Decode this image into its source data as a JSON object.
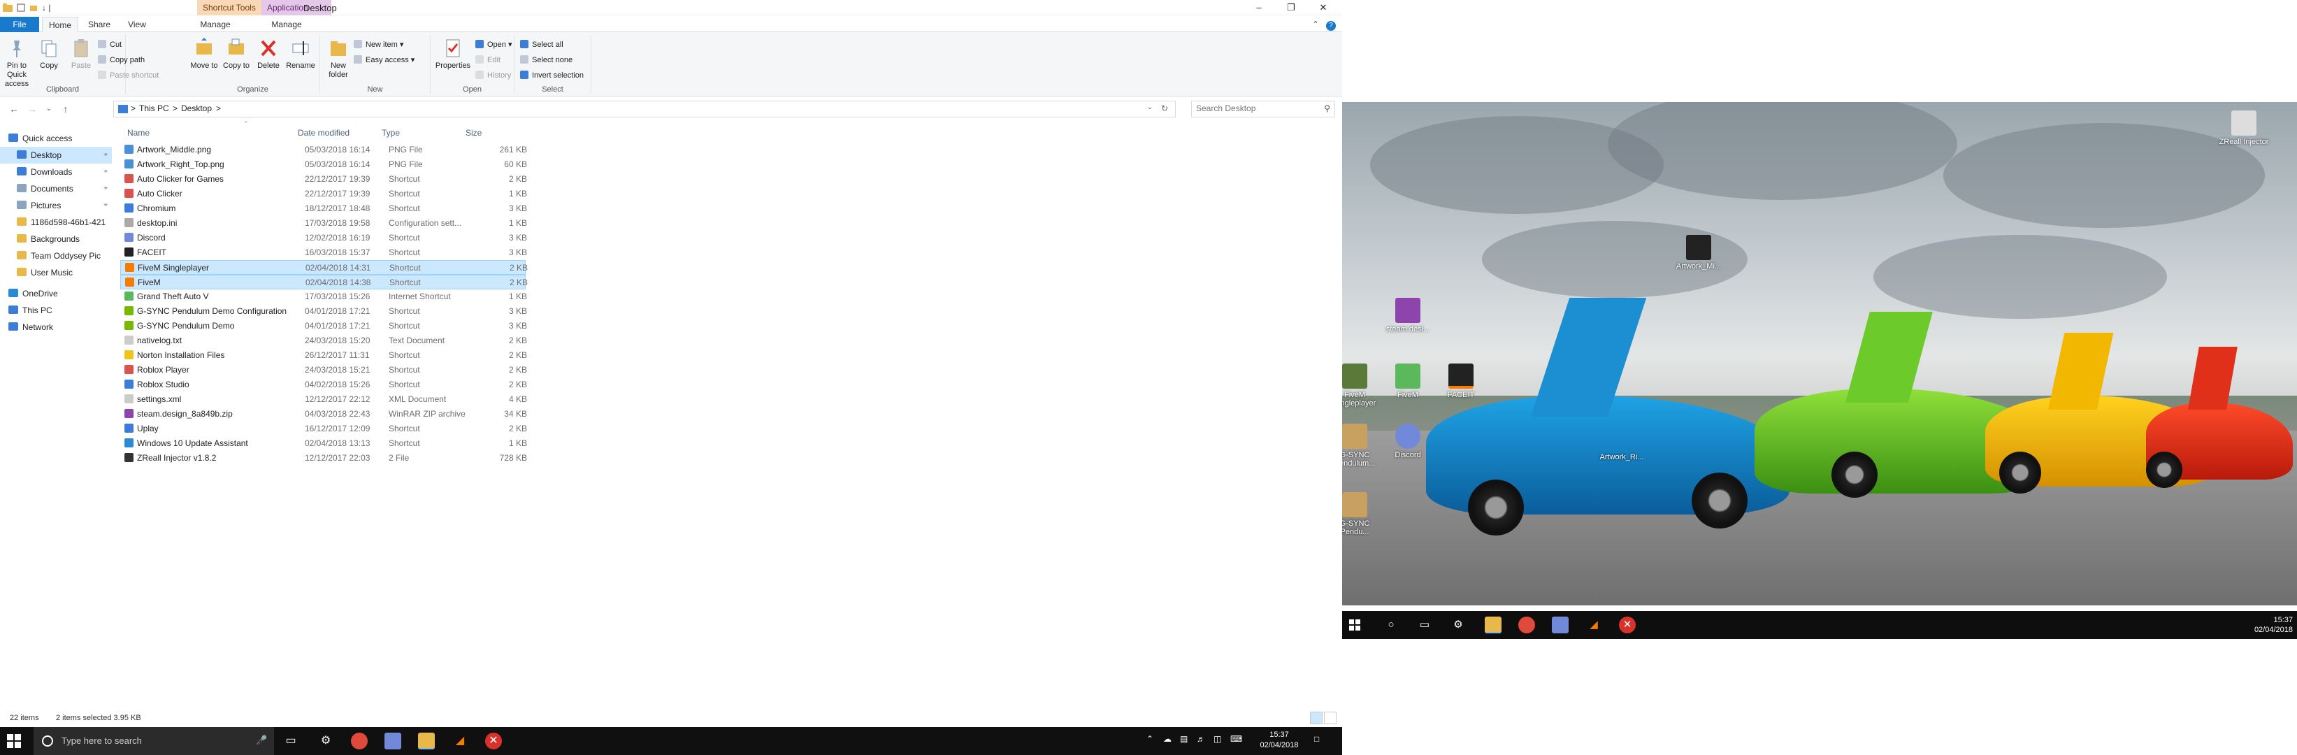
{
  "titlebar": {
    "quick_access_arrow": "↓ |",
    "context_tab_shortcut": "Shortcut Tools",
    "context_tab_application": "Application Tools",
    "window_title": "Desktop"
  },
  "tabs": [
    "File",
    "Home",
    "Share",
    "View",
    "Manage",
    "Manage"
  ],
  "ribbon": {
    "clipboard": {
      "label": "Clipboard",
      "pin": "Pin to Quick access",
      "copy": "Copy",
      "paste": "Paste",
      "cut": "Cut",
      "copy_path": "Copy path",
      "paste_shortcut": "Paste shortcut"
    },
    "organize": {
      "label": "Organize",
      "move_to": "Move to",
      "copy_to": "Copy to",
      "delete": "Delete",
      "rename": "Rename"
    },
    "new": {
      "label": "New",
      "new_folder": "New folder",
      "new_item": "New item ▾",
      "easy_access": "Easy access ▾"
    },
    "open": {
      "label": "Open",
      "properties": "Properties",
      "open": "Open ▾",
      "edit": "Edit",
      "history": "History"
    },
    "select": {
      "label": "Select",
      "select_all": "Select all",
      "select_none": "Select none",
      "invert": "Invert selection"
    }
  },
  "address": {
    "this_pc": "This PC",
    "sep": ">",
    "desktop": "Desktop",
    "search_placeholder": "Search Desktop"
  },
  "navpane": [
    {
      "label": "Quick access",
      "pinned": false
    },
    {
      "label": "Desktop",
      "pinned": true
    },
    {
      "label": "Downloads",
      "pinned": true
    },
    {
      "label": "Documents",
      "pinned": true
    },
    {
      "label": "Pictures",
      "pinned": true
    },
    {
      "label": "1186d598-46b1-421",
      "pinned": false
    },
    {
      "label": "Backgrounds",
      "pinned": false
    },
    {
      "label": "Team Oddysey Pic",
      "pinned": false
    },
    {
      "label": "User Music",
      "pinned": false
    },
    {
      "label": "OneDrive",
      "pinned": false
    },
    {
      "label": "This PC",
      "pinned": false
    },
    {
      "label": "Network",
      "pinned": false
    }
  ],
  "columns": {
    "name": "Name",
    "date": "Date modified",
    "type": "Type",
    "size": "Size"
  },
  "files": [
    {
      "name": "Artwork_Middle.png",
      "date": "05/03/2018 16:14",
      "type": "PNG File",
      "size": "261 KB",
      "color": "#4a90d9"
    },
    {
      "name": "Artwork_Right_Top.png",
      "date": "05/03/2018 16:14",
      "type": "PNG File",
      "size": "60 KB",
      "color": "#4a90d9"
    },
    {
      "name": "Auto Clicker for Games",
      "date": "22/12/2017 19:39",
      "type": "Shortcut",
      "size": "2 KB",
      "color": "#d9534f"
    },
    {
      "name": "Auto Clicker",
      "date": "22/12/2017 19:39",
      "type": "Shortcut",
      "size": "1 KB",
      "color": "#d9534f"
    },
    {
      "name": "Chromium",
      "date": "18/12/2017 18:48",
      "type": "Shortcut",
      "size": "3 KB",
      "color": "#3b7dd8"
    },
    {
      "name": "desktop.ini",
      "date": "17/03/2018 19:58",
      "type": "Configuration sett...",
      "size": "1 KB",
      "color": "#aaaaaa"
    },
    {
      "name": "Discord",
      "date": "12/02/2018 16:19",
      "type": "Shortcut",
      "size": "3 KB",
      "color": "#7289da"
    },
    {
      "name": "FACEIT",
      "date": "16/03/2018 15:37",
      "type": "Shortcut",
      "size": "3 KB",
      "color": "#222222"
    },
    {
      "name": "FiveM Singleplayer",
      "date": "02/04/2018 14:31",
      "type": "Shortcut",
      "size": "2 KB",
      "color": "#f57c00",
      "selected": true
    },
    {
      "name": "FiveM",
      "date": "02/04/2018 14:38",
      "type": "Shortcut",
      "size": "2 KB",
      "color": "#f57c00",
      "selected": true
    },
    {
      "name": "Grand Theft Auto V",
      "date": "17/03/2018 15:26",
      "type": "Internet Shortcut",
      "size": "1 KB",
      "color": "#5cb85c"
    },
    {
      "name": "G-SYNC Pendulum Demo Configuration",
      "date": "04/01/2018 17:21",
      "type": "Shortcut",
      "size": "3 KB",
      "color": "#76b900"
    },
    {
      "name": "G-SYNC Pendulum Demo",
      "date": "04/01/2018 17:21",
      "type": "Shortcut",
      "size": "3 KB",
      "color": "#76b900"
    },
    {
      "name": "nativelog.txt",
      "date": "24/03/2018 15:20",
      "type": "Text Document",
      "size": "2 KB",
      "color": "#cccccc"
    },
    {
      "name": "Norton Installation Files",
      "date": "26/12/2017 11:31",
      "type": "Shortcut",
      "size": "2 KB",
      "color": "#f0c419"
    },
    {
      "name": "Roblox Player",
      "date": "24/03/2018 15:21",
      "type": "Shortcut",
      "size": "2 KB",
      "color": "#d9534f"
    },
    {
      "name": "Roblox Studio",
      "date": "04/02/2018 15:26",
      "type": "Shortcut",
      "size": "2 KB",
      "color": "#3b7dd8"
    },
    {
      "name": "settings.xml",
      "date": "12/12/2017 22:12",
      "type": "XML Document",
      "size": "4 KB",
      "color": "#cccccc"
    },
    {
      "name": "steam.design_8a849b.zip",
      "date": "04/03/2018 22:43",
      "type": "WinRAR ZIP archive",
      "size": "34 KB",
      "color": "#8e44ad"
    },
    {
      "name": "Uplay",
      "date": "16/12/2017 12:09",
      "type": "Shortcut",
      "size": "2 KB",
      "color": "#3b7dd8"
    },
    {
      "name": "Windows 10 Update Assistant",
      "date": "02/04/2018 13:13",
      "type": "Shortcut",
      "size": "1 KB",
      "color": "#2a8ad4"
    },
    {
      "name": "ZReall Injector v1.8.2",
      "date": "12/12/2017 22:03",
      "type": "2 File",
      "size": "728 KB",
      "color": "#333333"
    }
  ],
  "status": {
    "items": "22 items",
    "selected": "2 items selected  3.95 KB"
  },
  "taskbar": {
    "search_placeholder": "Type here to search",
    "time": "15:37",
    "date": "02/04/2018"
  },
  "desktop": {
    "icons": [
      {
        "label": "ZReall Injector",
        "color": "#dddddd"
      },
      {
        "label": "Artwork_Mi...",
        "color": "#222222"
      },
      {
        "label": "steam.desi...",
        "color": "#8e44ad"
      },
      {
        "label": "FiveM Singleplayer",
        "color": "#5a7a3a"
      },
      {
        "label": "FiveM",
        "color": "#5cb85c"
      },
      {
        "label": "FACEIT",
        "color": "#f57c00"
      },
      {
        "label": "G-SYNC Pendulum...",
        "color": "#c8a060"
      },
      {
        "label": "Discord",
        "color": "#7289da"
      },
      {
        "label": "G-SYNC Pendu...",
        "color": "#c8a060"
      }
    ],
    "caption": "Artwork_Ri...",
    "time": "15:37",
    "date": "02/04/2018"
  }
}
